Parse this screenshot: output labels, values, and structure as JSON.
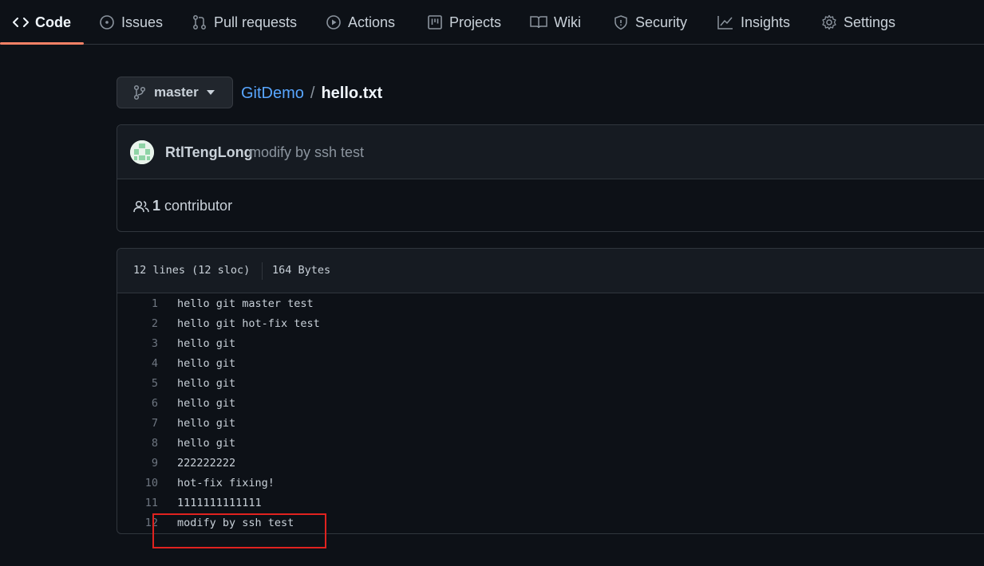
{
  "nav": {
    "tabs": [
      {
        "label": "Code",
        "icon": "code-icon",
        "selected": true
      },
      {
        "label": "Issues",
        "icon": "issue-icon"
      },
      {
        "label": "Pull requests",
        "icon": "pull-request-icon"
      },
      {
        "label": "Actions",
        "icon": "play-icon"
      },
      {
        "label": "Projects",
        "icon": "project-icon"
      },
      {
        "label": "Wiki",
        "icon": "book-icon"
      },
      {
        "label": "Security",
        "icon": "shield-icon"
      },
      {
        "label": "Insights",
        "icon": "graph-icon"
      },
      {
        "label": "Settings",
        "icon": "gear-icon"
      }
    ],
    "selected_accent": "#f78166"
  },
  "branch": {
    "name": "master"
  },
  "breadcrumb": {
    "repo": "GitDemo",
    "separator": "/",
    "file": "hello.txt"
  },
  "commit": {
    "author": "RtlTengLong",
    "message": "modify by ssh test",
    "contributors_count": "1",
    "contributors_label": "contributor"
  },
  "file": {
    "lines_info": "12 lines (12 sloc)",
    "size": "164 Bytes",
    "code": [
      {
        "num": "1",
        "text": "hello git master test"
      },
      {
        "num": "2",
        "text": "hello git hot-fix test"
      },
      {
        "num": "3",
        "text": "hello git"
      },
      {
        "num": "4",
        "text": "hello git"
      },
      {
        "num": "5",
        "text": "hello git"
      },
      {
        "num": "6",
        "text": "hello git"
      },
      {
        "num": "7",
        "text": "hello git"
      },
      {
        "num": "8",
        "text": "hello git"
      },
      {
        "num": "9",
        "text": "222222222"
      },
      {
        "num": "10",
        "text": "hot-fix fixing!"
      },
      {
        "num": "11",
        "text": "1111111111111"
      },
      {
        "num": "12",
        "text": "modify by ssh test"
      }
    ]
  },
  "colors": {
    "background": "#0d1117",
    "link": "#58a6ff",
    "annotation": "#e0221f"
  }
}
